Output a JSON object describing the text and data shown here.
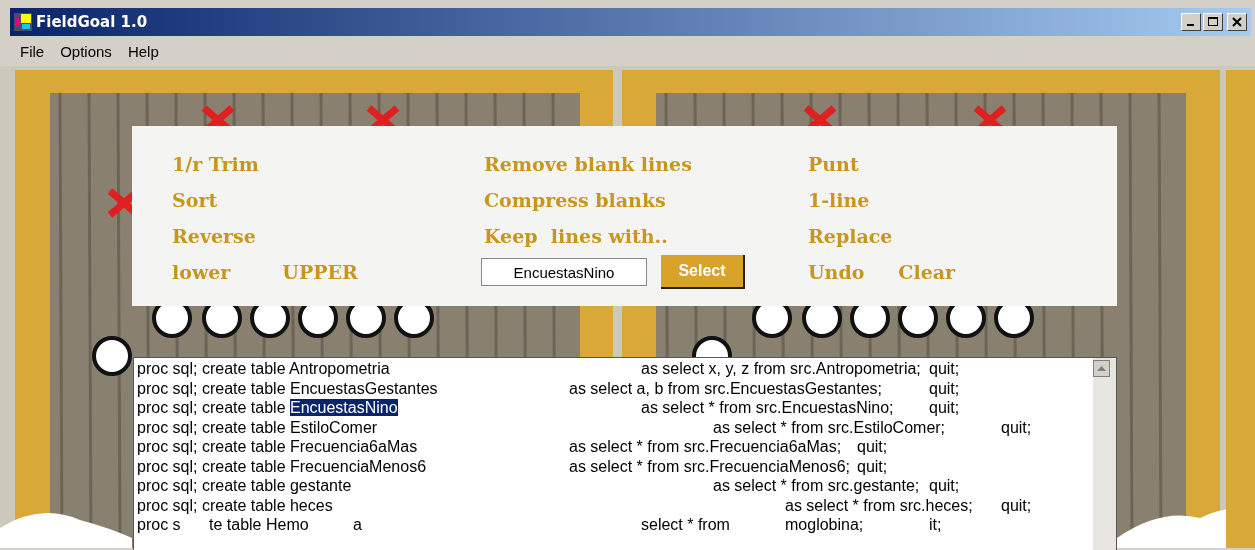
{
  "window": {
    "title": "FieldGoal 1.0"
  },
  "menu": [
    "File",
    "Options",
    "Help"
  ],
  "tools": {
    "left": [
      [
        {
          "kind": "text-button",
          "label": "1/r Trim"
        }
      ],
      [
        {
          "kind": "text-button",
          "label": "Sort"
        }
      ],
      [
        {
          "kind": "text-button",
          "label": "Reverse"
        }
      ],
      [
        {
          "kind": "text-button",
          "label": "lower"
        },
        {
          "kind": "text-button",
          "label": "UPPER"
        }
      ]
    ],
    "middle": [
      [
        {
          "kind": "text-button",
          "label": "Remove blank lines"
        }
      ],
      [
        {
          "kind": "text-button",
          "label": "Compress blanks"
        }
      ],
      [
        {
          "kind": "text-button",
          "label": "Keep  lines with.."
        }
      ],
      [
        {
          "kind": "input",
          "value": "EncuestasNino"
        },
        {
          "kind": "button",
          "label": "Select"
        }
      ]
    ],
    "right": [
      [
        {
          "kind": "text-button",
          "label": "Punt"
        }
      ],
      [
        {
          "kind": "text-button",
          "label": "1-line"
        }
      ],
      [
        {
          "kind": "text-button",
          "label": "Replace"
        }
      ],
      [
        {
          "kind": "text-button",
          "label": "Undo"
        },
        {
          "kind": "text-button",
          "label": "Clear"
        }
      ]
    ]
  },
  "lines": [
    [
      {
        "text": "proc sql; create table Antropometria\t\t\t\tas select x, y, z from src.Antropometria;\tquit;",
        "selected": false
      }
    ],
    [
      {
        "text": "proc sql; create table EncuestasGestantes\t\tas select a, b from src.EncuestasGestantes;\tquit;",
        "selected": false
      }
    ],
    [
      {
        "text": "proc sql; create table ",
        "selected": false
      },
      {
        "text": "EncuestasNino",
        "selected": true
      },
      {
        "text": "\t\t\t\tas select * from src.EncuestasNino;\tquit;",
        "selected": false
      }
    ],
    [
      {
        "text": "proc sql; create table EstiloComer\t\t\t\t\tas select * from src.EstiloComer;\tquit;",
        "selected": false
      }
    ],
    [
      {
        "text": "proc sql; create table Frecuencia6aMas\t\t\tas select * from src.Frecuencia6aMas;\tquit;",
        "selected": false
      }
    ],
    [
      {
        "text": "proc sql; create table FrecuenciaMenos6\t\tas select * from src.FrecuenciaMenos6;\tquit;",
        "selected": false
      }
    ],
    [
      {
        "text": "proc sql; create table gestante\t\t\t\t\tas select * from src.gestante;\tquit;",
        "selected": false
      }
    ],
    [
      {
        "text": "proc sql; create table heces\t\t\t\t\t\t\tas select * from src.heces;\tquit;",
        "selected": false
      }
    ],
    [
      {
        "text": "proc s\tte table Hemo\ta\t\t\t\tselect * from\tmoglobina;\tit;",
        "selected": false
      }
    ]
  ]
}
